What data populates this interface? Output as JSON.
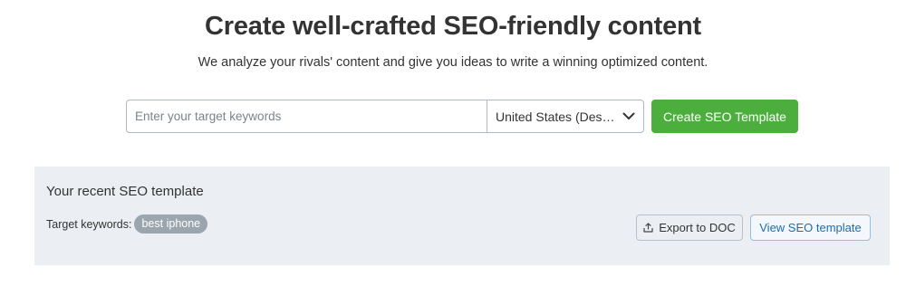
{
  "header": {
    "title": "Create well-crafted SEO-friendly content",
    "subtitle": "We analyze your rivals' content and give you ideas to write a winning optimized content."
  },
  "search": {
    "keyword_placeholder": "Enter your target keywords",
    "keyword_value": "",
    "country_selected": "United States (Des…",
    "create_button_label": "Create SEO Template"
  },
  "recent": {
    "title": "Your recent SEO template",
    "target_label": "Target keywords:",
    "keywords": [
      "best iphone"
    ],
    "export_label": "Export to DOC",
    "view_label": "View SEO template"
  },
  "icons": {
    "dropdown": "chevron-down-icon",
    "export": "upload-icon"
  },
  "colors": {
    "accent_green": "#4caf3d",
    "panel_bg": "#ebeff3",
    "link_blue": "#1b6db2",
    "chip_gray": "#9aa5ad"
  }
}
